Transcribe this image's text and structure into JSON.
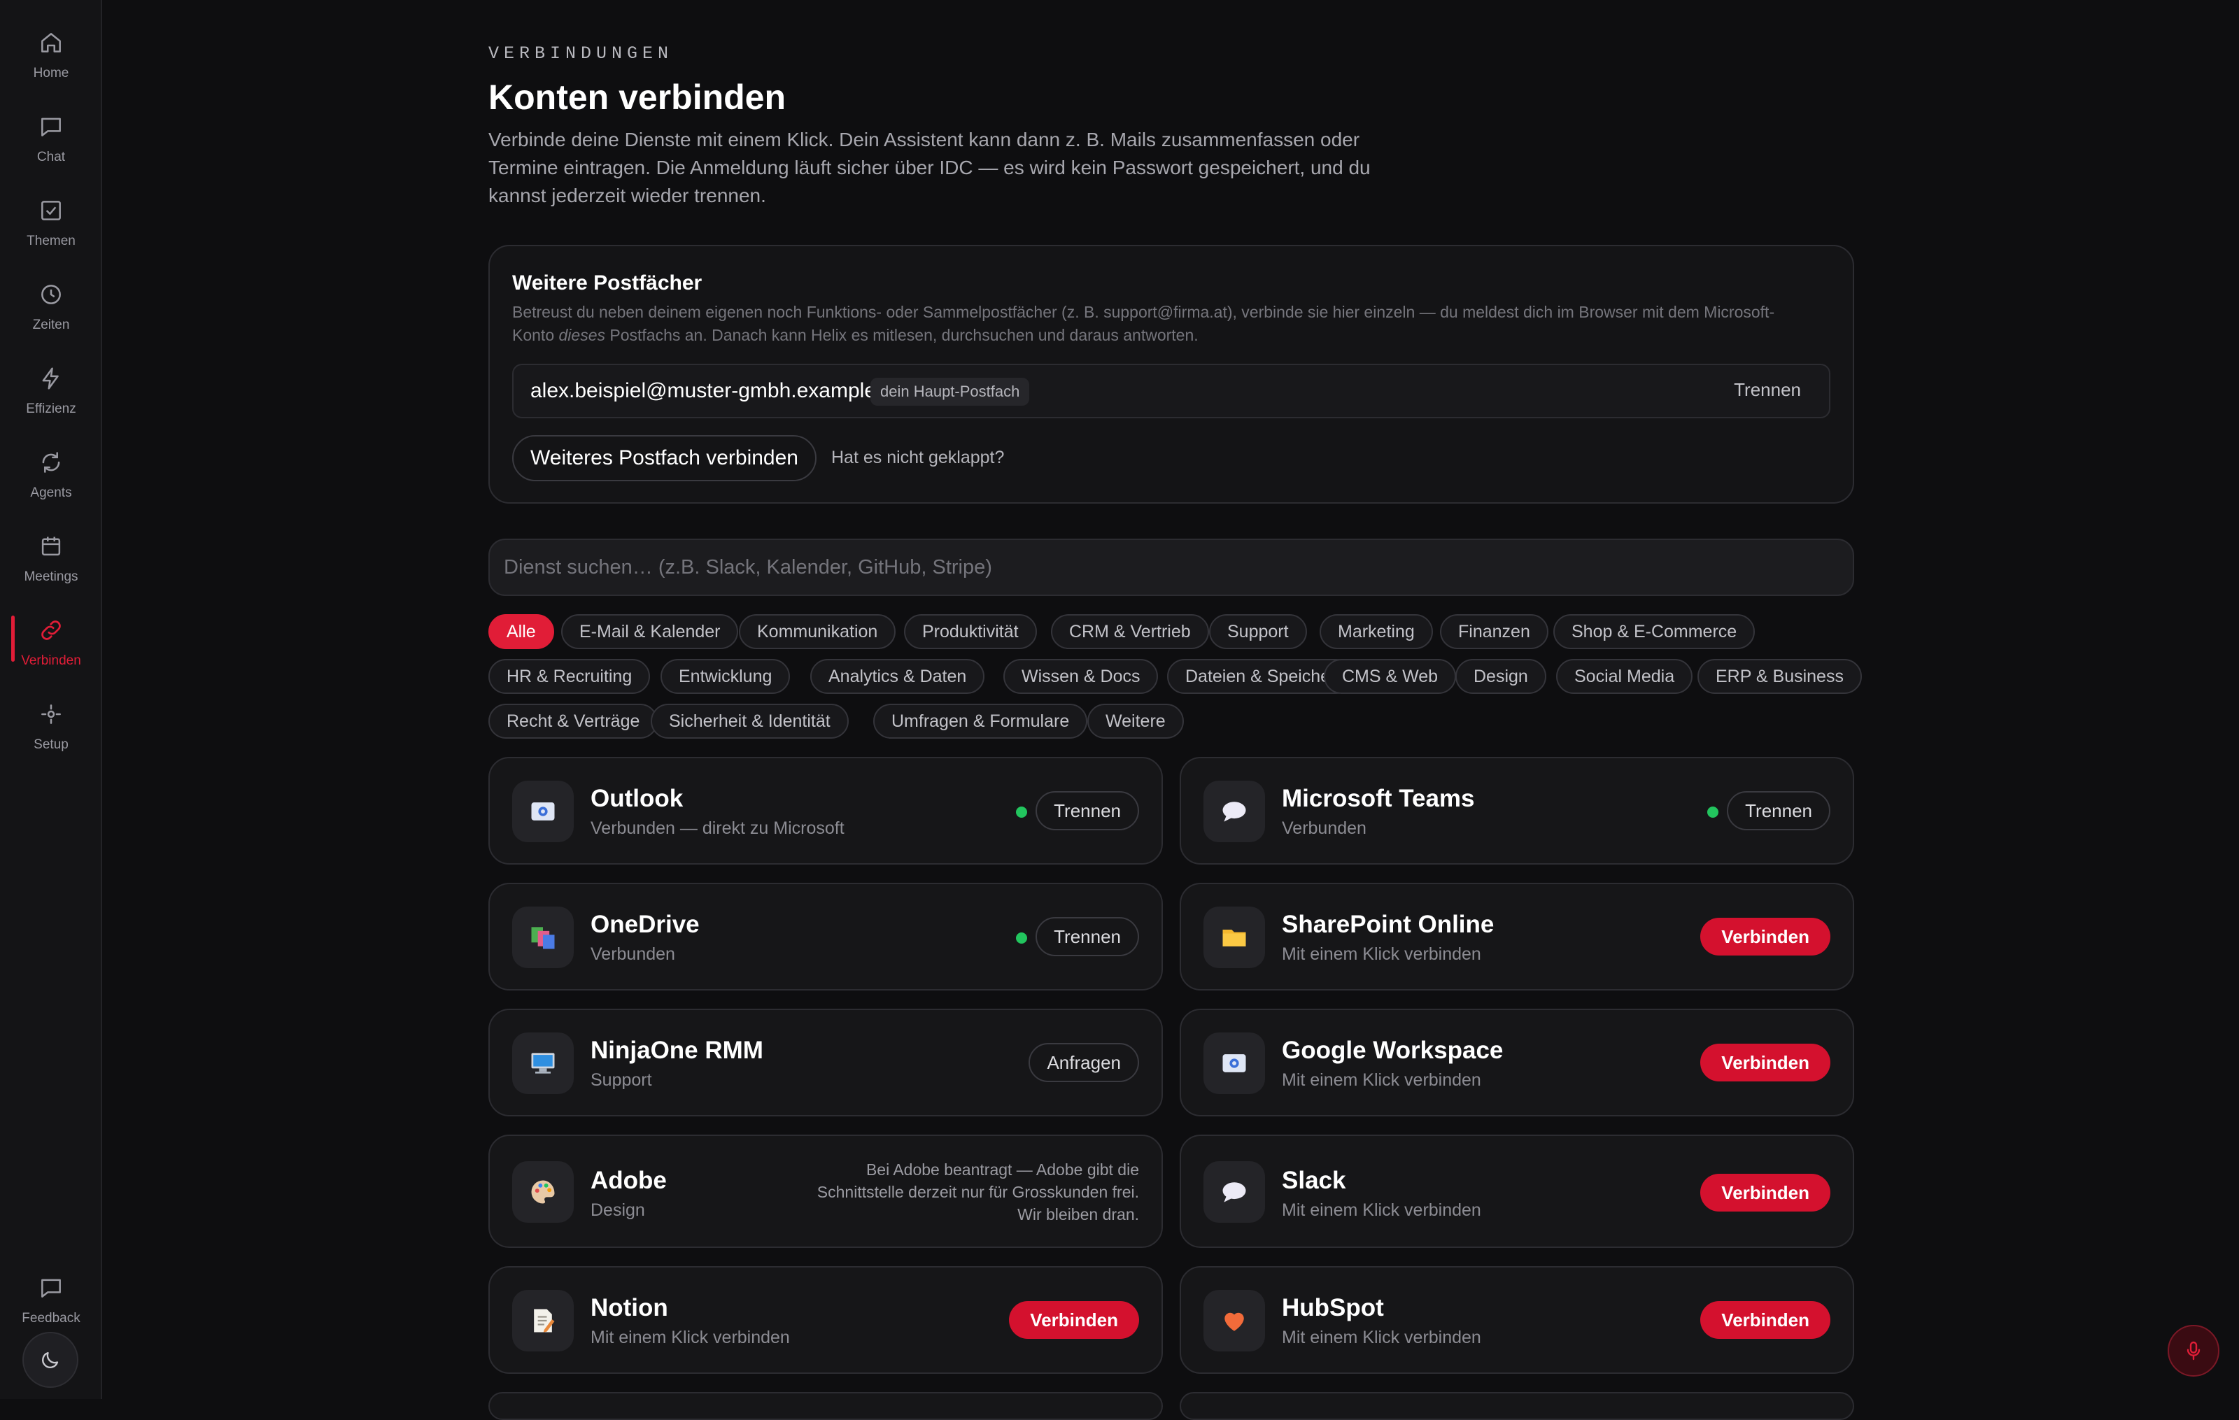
{
  "sidebar": {
    "items": [
      {
        "label": "Home",
        "icon": "home-icon"
      },
      {
        "label": "Chat",
        "icon": "chat-icon"
      },
      {
        "label": "Themen",
        "icon": "checkbox-icon"
      },
      {
        "label": "Zeiten",
        "icon": "clock-icon"
      },
      {
        "label": "Effizienz",
        "icon": "lightning-icon"
      },
      {
        "label": "Agents",
        "icon": "refresh-icon"
      },
      {
        "label": "Meetings",
        "icon": "calendar-icon"
      },
      {
        "label": "Verbinden",
        "icon": "link-icon",
        "active": true
      },
      {
        "label": "Setup",
        "icon": "setup-icon"
      }
    ],
    "feedback_label": "Feedback",
    "accent_color": "#e11d37"
  },
  "header": {
    "eyebrow": "VERBINDUNGEN",
    "title": "Konten verbinden",
    "intro": "Verbinde deine Dienste mit einem Klick. Dein Assistent kann dann z. B. Mails zusammenfassen oder Termine eintragen. Die Anmeldung läuft sicher über IDC — es wird kein Passwort gespeichert, und du kannst jederzeit wieder trennen."
  },
  "mailboxes": {
    "title": "Weitere Postfächer",
    "description_before": "Betreust du neben deinem eigenen noch Funktions- oder Sammelpostfächer (z. B. support@firma.at), verbinde sie hier einzeln — du meldest dich im Browser mit dem Microsoft-Konto ",
    "description_emph": "dieses",
    "description_after": " Postfachs an. Danach kann Helix es mitlesen, durchsuchen und daraus antworten.",
    "primary_email": "alex.beispiel@muster-gmbh.example",
    "primary_badge": "dein Haupt-Postfach",
    "disconnect_label": "Trennen",
    "add_button": "Weiteres Postfach verbinden",
    "help_link": "Hat es nicht geklappt?"
  },
  "search": {
    "placeholder": "Dienst suchen… (z.B. Slack, Kalender, GitHub, Stripe)"
  },
  "filters": {
    "rows": [
      [
        "Alle",
        "E-Mail & Kalender",
        "Kommunikation",
        "Produktivität",
        "CRM & Vertrieb",
        "Support",
        "Marketing",
        "Finanzen",
        "Shop & E-Commerce"
      ],
      [
        "HR & Recruiting",
        "Entwicklung",
        "Analytics & Daten",
        "Wissen & Docs",
        "Dateien & Speicher",
        "CMS & Web",
        "Design",
        "Social Media",
        "ERP & Business"
      ],
      [
        "Recht & Verträge",
        "Sicherheit & Identität",
        "Umfragen & Formulare",
        "Weitere"
      ]
    ],
    "active": "Alle"
  },
  "services": [
    {
      "name": "Outlook",
      "subtitle": "Verbunden — direkt zu Microsoft",
      "state": "connected",
      "action": "Trennen",
      "icon": "mail-icon"
    },
    {
      "name": "Microsoft Teams",
      "subtitle": "Verbunden",
      "state": "connected",
      "action": "Trennen",
      "icon": "speech-bubble-icon"
    },
    {
      "name": "OneDrive",
      "subtitle": "Verbunden",
      "state": "connected",
      "action": "Trennen",
      "icon": "files-icon"
    },
    {
      "name": "SharePoint Online",
      "subtitle": "Mit einem Klick verbinden",
      "state": "available",
      "action": "Verbinden",
      "icon": "folder-icon"
    },
    {
      "name": "NinjaOne RMM",
      "subtitle": "Support",
      "state": "request",
      "action": "Anfragen",
      "icon": "monitor-icon"
    },
    {
      "name": "Google Workspace",
      "subtitle": "Mit einem Klick verbinden",
      "state": "available",
      "action": "Verbinden",
      "icon": "mail-icon"
    },
    {
      "name": "Adobe",
      "subtitle": "Design",
      "state": "pending",
      "note": "Bei Adobe beantragt — Adobe gibt die Schnittstelle derzeit nur für Grosskunden frei. Wir bleiben dran.",
      "icon": "palette-icon"
    },
    {
      "name": "Slack",
      "subtitle": "Mit einem Klick verbinden",
      "state": "available",
      "action": "Verbinden",
      "icon": "speech-bubble-icon"
    },
    {
      "name": "Notion",
      "subtitle": "Mit einem Klick verbinden",
      "state": "available",
      "action": "Verbinden",
      "icon": "memo-icon"
    },
    {
      "name": "HubSpot",
      "subtitle": "Mit einem Klick verbinden",
      "state": "available",
      "action": "Verbinden",
      "icon": "heart-icon"
    }
  ],
  "colors": {
    "connected_dot": "#22c55e",
    "primary_button": "#d4112e"
  }
}
